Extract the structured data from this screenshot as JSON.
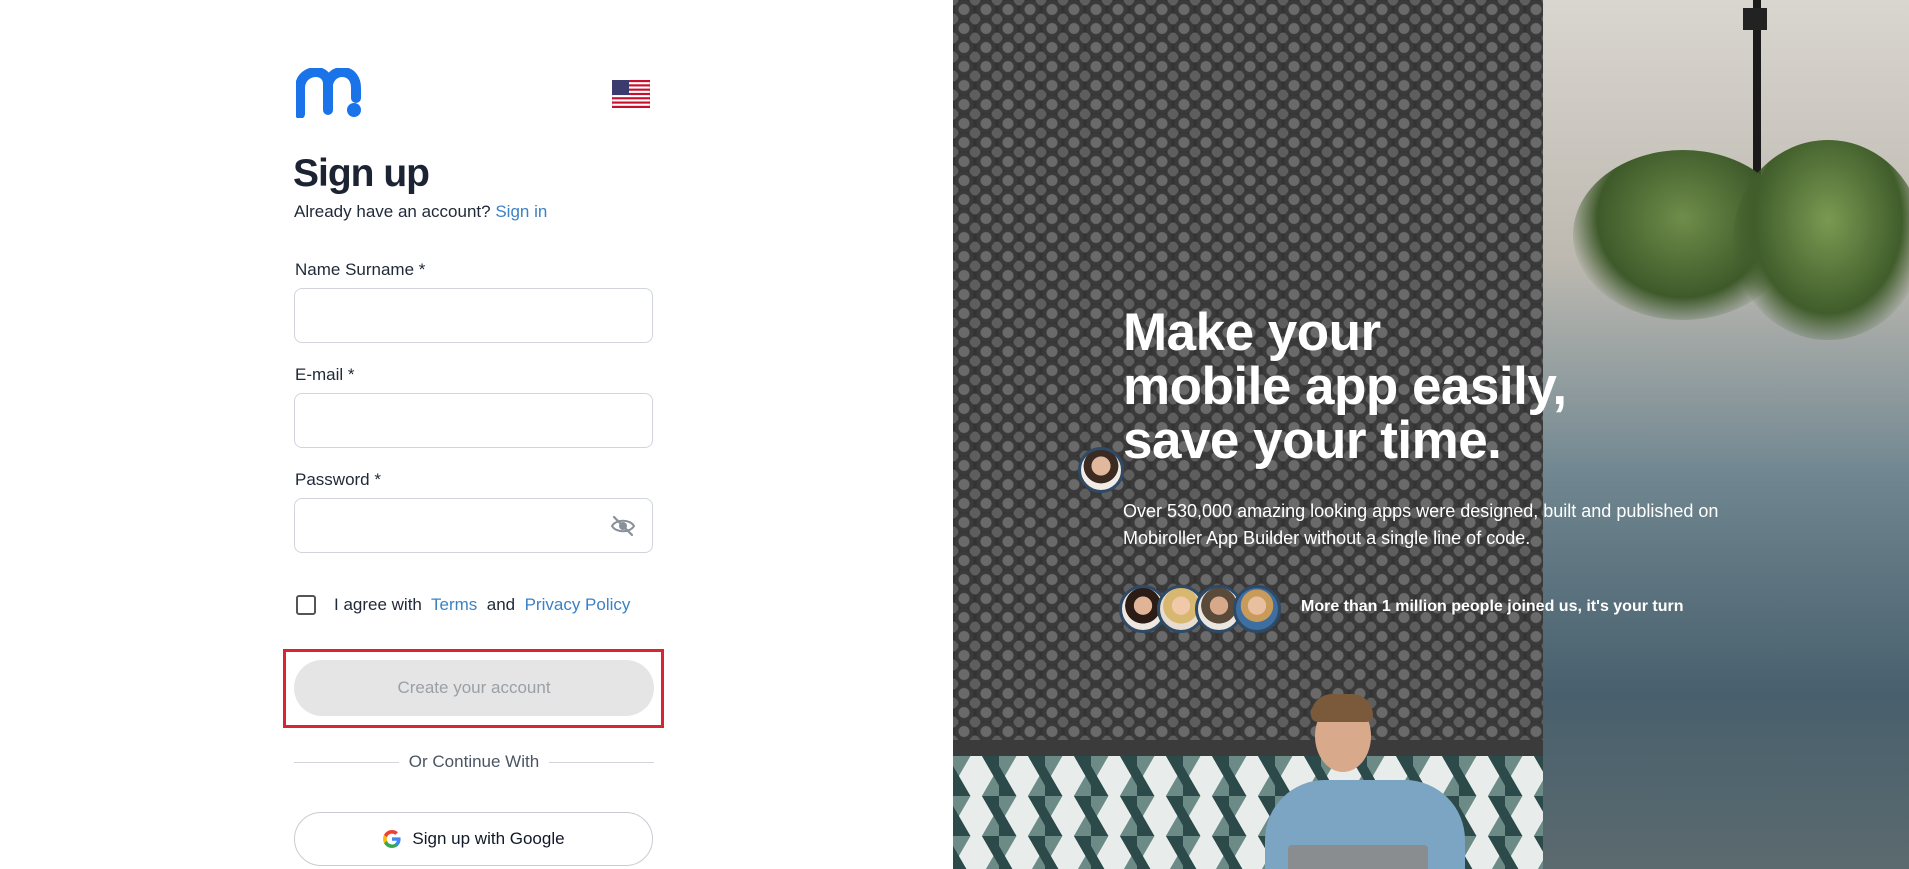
{
  "signup": {
    "title": "Sign up",
    "already_text": "Already have an account?",
    "sign_in_link": "Sign in",
    "fields": {
      "name_label": "Name Surname *",
      "email_label": "E-mail *",
      "password_label": "Password *"
    },
    "agree_prefix": "I agree with",
    "terms_link": "Terms",
    "and_text": "and",
    "privacy_link": "Privacy Policy",
    "create_button": "Create your account",
    "divider_text": "Or Continue With",
    "google_button": "Sign up with Google"
  },
  "hero": {
    "headline_line1": "Make your",
    "headline_line2": "mobile app easily,",
    "headline_line3": "save your time.",
    "subtext": "Over 530,000 amazing looking apps were designed, built and published on Mobiroller App Builder without a single line of code.",
    "joined_text": "More than 1 million people joined us, it's your turn"
  },
  "colors": {
    "brand_blue": "#1a73e8",
    "link_blue": "#3b82c4",
    "highlight_red": "#d7262e",
    "disabled_button": "#e5e5e5"
  },
  "icons": {
    "logo": "mobiroller-logo",
    "flag": "us-flag-icon",
    "eye": "eye-off-icon",
    "google": "google-g-icon"
  }
}
